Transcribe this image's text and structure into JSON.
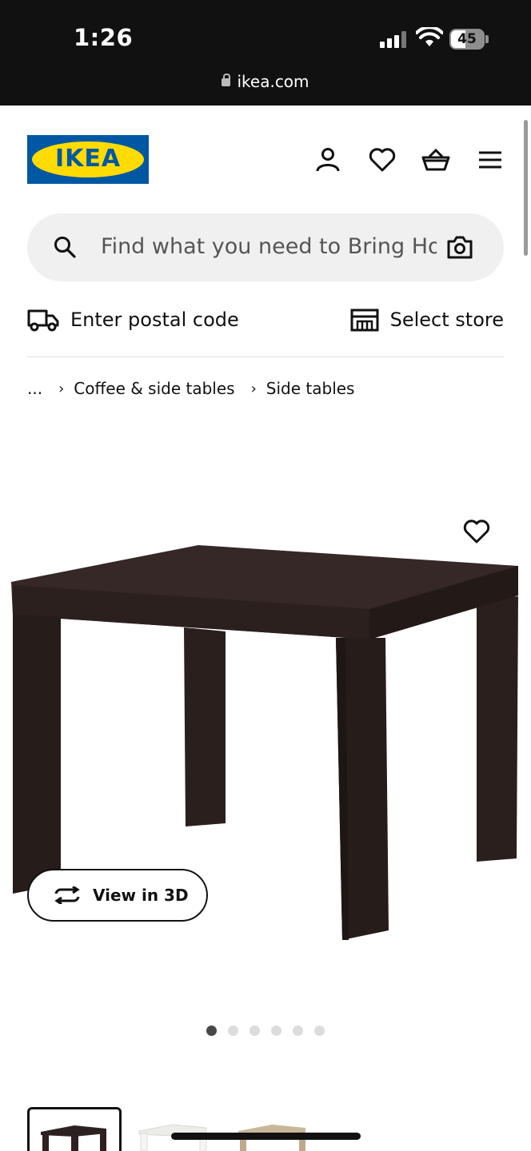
{
  "status_bar": {
    "time": "1:26",
    "battery": "45",
    "url": "ikea.com"
  },
  "header": {
    "logo_text": "IKEA",
    "logo_reg": "®"
  },
  "search": {
    "placeholder": "Find what you need to Bring Hor"
  },
  "delivery": {
    "postal_label": "Enter postal code",
    "store_label": "Select store"
  },
  "breadcrumb": {
    "ellipsis": "...",
    "items": [
      "Coffee & side tables",
      "Side tables"
    ]
  },
  "product": {
    "view3d_label": "View in 3D",
    "image_count": 6,
    "active_image": 1,
    "thumbnail_colors": [
      "#2c2020",
      "#f4f4f2",
      "#c9b79c"
    ]
  },
  "colors": {
    "ikea_blue": "#0058a3",
    "ikea_yellow": "#ffdb00",
    "table_color": "#2e2220"
  }
}
